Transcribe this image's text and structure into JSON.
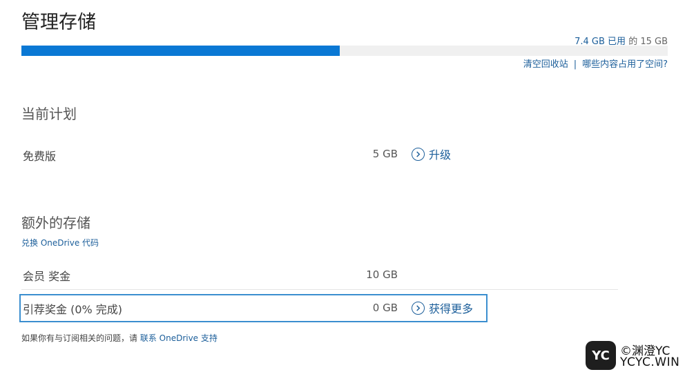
{
  "page": {
    "title": "管理存储"
  },
  "usage": {
    "used_text": "7.4 GB 已用",
    "middle": " 的 ",
    "total_text": "15 GB",
    "used_fraction": 0.493
  },
  "links": {
    "empty_recycle_bin": "清空回收站",
    "separator": "|",
    "whats_using_space": "哪些内容占用了空间?"
  },
  "current_plan": {
    "heading": "当前计划",
    "name": "免费版",
    "size": "5 GB",
    "action_label": "升级",
    "action_icon": "chevron-right-circle-icon"
  },
  "extra_storage": {
    "heading": "额外的存储",
    "redeem_link": "兑换 OneDrive 代码",
    "rows": [
      {
        "label": "会员 奖金",
        "size": "10 GB"
      },
      {
        "label": "引荐奖金 (0% 完成)",
        "size": "0 GB",
        "action_label": "获得更多",
        "action_icon": "chevron-right-circle-icon"
      }
    ]
  },
  "footer": {
    "prefix": "如果你有与订阅相关的问题，请 ",
    "link": "联系 OneDrive 支持"
  },
  "watermark": {
    "logo_text": "YC",
    "line1": "©渊澄YC",
    "line2": "YCYC.WIN"
  },
  "colors": {
    "accent": "#0a78d4",
    "link": "#1b5e9a",
    "highlight_border": "#3a8ecf"
  }
}
